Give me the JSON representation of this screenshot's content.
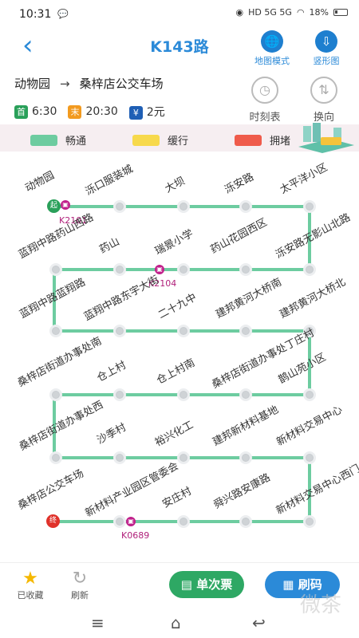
{
  "status": {
    "time": "10:31",
    "battery": "18%",
    "signals": "HD 5G 5G"
  },
  "header": {
    "title": "K143路",
    "back_icon": "‹",
    "map_mode_label": "地图模式",
    "vertical_label": "竖形图"
  },
  "route": {
    "from": "动物园",
    "arrow": "→",
    "to": "桑梓店公交车场"
  },
  "info": {
    "first_tag": "首",
    "first_time": "6:30",
    "last_tag": "末",
    "last_time": "20:30",
    "fare_icon": "¥",
    "fare": "2元"
  },
  "actions": {
    "timetable_label": "时刻表",
    "reverse_label": "换向"
  },
  "legend": {
    "smooth": "畅通",
    "slow": "缓行",
    "jam": "拥堵",
    "colors": {
      "smooth": "#6dcca0",
      "slow": "#f7d94c",
      "jam": "#ef5b4b"
    }
  },
  "stations": {
    "r1": [
      "动物园",
      "泺口服装城",
      "大坝",
      "泺安路",
      "太平洋小区"
    ],
    "r2": [
      "蓝翔中路药山西路",
      "药山",
      "瑞景小学",
      "药山花园西区",
      "泺安路无影山北路"
    ],
    "r3": [
      "蓝翔中路蓝翔路",
      "蓝翔中路东宇大街",
      "二十九中",
      "建邦黄河大桥南",
      "建邦黄河大桥北"
    ],
    "r4": [
      "桑梓店街道办事处南",
      "仓上村",
      "仓上村南",
      "桑梓店街道办事处丁庄村",
      "鹊山苑小区"
    ],
    "r5": [
      "桑梓店街道办事处西",
      "沙季村",
      "裕兴化工",
      "建邦新材料基地",
      "新材料交易中心"
    ],
    "r6": [
      "桑梓店公交车场",
      "新材料产业园区管委会",
      "安庄村",
      "舜兴路安康路",
      "新材料交易中心西门"
    ]
  },
  "buses": {
    "b1": "K2101",
    "b2": "K2104",
    "b3": "K0689"
  },
  "markers": {
    "start": "起",
    "end": "终"
  },
  "bottom": {
    "fav_label": "已收藏",
    "refresh_label": "刷新",
    "ticket_label": "单次票",
    "scan_label": "刷码"
  },
  "watermark": "微茶"
}
